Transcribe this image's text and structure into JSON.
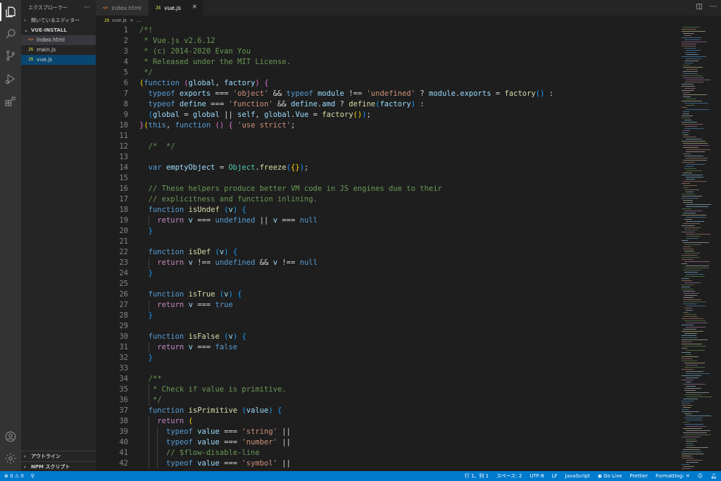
{
  "activity_bar": {
    "icons": [
      "files-icon",
      "search-icon",
      "source-control-icon",
      "run-debug-icon",
      "extensions-icon",
      "account-icon",
      "settings-gear-icon"
    ]
  },
  "sidebar": {
    "title": "エクスプローラー",
    "more": "···",
    "open_editors": "開いているエディター",
    "folder": "VUE-INSTALL",
    "files": [
      {
        "name": "index.html",
        "badge": "<>"
      },
      {
        "name": "main.js",
        "badge": "JS"
      },
      {
        "name": "vue.js",
        "badge": "JS"
      }
    ],
    "outline": "アウトライン",
    "npm_scripts": "NPM スクリプト"
  },
  "tabs": [
    {
      "label": "index.html",
      "badge": "<>"
    },
    {
      "label": "vue.js",
      "badge": "JS",
      "close": "×"
    }
  ],
  "breadcrumb": {
    "badge": "JS",
    "file": "vue.js",
    "sep": ">",
    "rest": "..."
  },
  "editor": {
    "lines": [
      {
        "n": "1",
        "html": "<span class=\"c\">/*!</span>"
      },
      {
        "n": "2",
        "html": "<span class=\"c\"> * Vue.js v2.6.12</span>"
      },
      {
        "n": "3",
        "html": "<span class=\"c\"> * (c) 2014-2020 Evan You</span>"
      },
      {
        "n": "4",
        "html": "<span class=\"c\"> * Released under the MIT License.</span>"
      },
      {
        "n": "5",
        "html": "<span class=\"c\"> */</span>"
      },
      {
        "n": "6",
        "html": "<span class=\"b1\">(</span><span class=\"k\">function</span> <span class=\"b2\">(</span><span class=\"v\">global</span>, <span class=\"v\">factory</span><span class=\"b2\">)</span> <span class=\"b2\">{</span>"
      },
      {
        "n": "7",
        "html": "  <span class=\"k\">typeof</span> <span class=\"v\">exports</span> === <span class=\"s\">'object'</span> &amp;&amp; <span class=\"k\">typeof</span> <span class=\"v\">module</span> !== <span class=\"s\">'undefined'</span> ? <span class=\"v\">module</span>.<span class=\"v\">exports</span> = <span class=\"f\">factory</span><span class=\"b3\">()</span> :"
      },
      {
        "n": "8",
        "html": "  <span class=\"k\">typeof</span> <span class=\"v\">define</span> === <span class=\"s\">'function'</span> &amp;&amp; <span class=\"v\">define</span>.<span class=\"v\">amd</span> ? <span class=\"f\">define</span><span class=\"b3\">(</span><span class=\"v\">factory</span><span class=\"b3\">)</span> :"
      },
      {
        "n": "9",
        "html": "  <span class=\"b3\">(</span><span class=\"v\">global</span> = <span class=\"v\">global</span> || <span class=\"v\">self</span>, <span class=\"v\">global</span>.<span class=\"v\">Vue</span> = <span class=\"f\">factory</span><span class=\"b1\">()</span><span class=\"b3\">)</span>;"
      },
      {
        "n": "10",
        "html": "<span class=\"b2\">}</span><span class=\"b1\">(</span><span class=\"k\">this</span>, <span class=\"k\">function</span> <span class=\"b2\">()</span> <span class=\"b2\">{</span> <span class=\"s\">'use strict'</span>;"
      },
      {
        "n": "11",
        "html": ""
      },
      {
        "n": "12",
        "html": "  <span class=\"c\">/*  */</span>"
      },
      {
        "n": "13",
        "html": ""
      },
      {
        "n": "14",
        "html": "  <span class=\"k\">var</span> <span class=\"v\">emptyObject</span> = <span class=\"t\">Object</span>.<span class=\"f\">freeze</span><span class=\"b3\">(</span><span class=\"b1\">{}</span><span class=\"b3\">)</span>;"
      },
      {
        "n": "15",
        "html": ""
      },
      {
        "n": "16",
        "html": "  <span class=\"c\">// These helpers produce better VM code in JS engines due to their</span>"
      },
      {
        "n": "17",
        "html": "  <span class=\"c\">// explicitness and function inlining.</span>"
      },
      {
        "n": "18",
        "html": "  <span class=\"k\">function</span> <span class=\"f\">isUndef</span> <span class=\"b3\">(</span><span class=\"v\">v</span><span class=\"b3\">)</span> <span class=\"b3\">{</span>"
      },
      {
        "n": "19",
        "html": "    <span class=\"ctl\">return</span> <span class=\"v\">v</span> === <span class=\"k\">undefined</span> || <span class=\"v\">v</span> === <span class=\"k\">null</span>"
      },
      {
        "n": "20",
        "html": "  <span class=\"b3\">}</span>"
      },
      {
        "n": "21",
        "html": ""
      },
      {
        "n": "22",
        "html": "  <span class=\"k\">function</span> <span class=\"f\">isDef</span> <span class=\"b3\">(</span><span class=\"v\">v</span><span class=\"b3\">)</span> <span class=\"b3\">{</span>"
      },
      {
        "n": "23",
        "html": "    <span class=\"ctl\">return</span> <span class=\"v\">v</span> !== <span class=\"k\">undefined</span> &amp;&amp; <span class=\"v\">v</span> !== <span class=\"k\">null</span>"
      },
      {
        "n": "24",
        "html": "  <span class=\"b3\">}</span>"
      },
      {
        "n": "25",
        "html": ""
      },
      {
        "n": "26",
        "html": "  <span class=\"k\">function</span> <span class=\"f\">isTrue</span> <span class=\"b3\">(</span><span class=\"v\">v</span><span class=\"b3\">)</span> <span class=\"b3\">{</span>"
      },
      {
        "n": "27",
        "html": "    <span class=\"ctl\">return</span> <span class=\"v\">v</span> === <span class=\"k\">true</span>"
      },
      {
        "n": "28",
        "html": "  <span class=\"b3\">}</span>"
      },
      {
        "n": "29",
        "html": ""
      },
      {
        "n": "30",
        "html": "  <span class=\"k\">function</span> <span class=\"f\">isFalse</span> <span class=\"b3\">(</span><span class=\"v\">v</span><span class=\"b3\">)</span> <span class=\"b3\">{</span>"
      },
      {
        "n": "31",
        "html": "    <span class=\"ctl\">return</span> <span class=\"v\">v</span> === <span class=\"k\">false</span>"
      },
      {
        "n": "32",
        "html": "  <span class=\"b3\">}</span>"
      },
      {
        "n": "33",
        "html": ""
      },
      {
        "n": "34",
        "html": "  <span class=\"c\">/**</span>"
      },
      {
        "n": "35",
        "html": "<span class=\"c\">   * Check if value is primitive.</span>"
      },
      {
        "n": "36",
        "html": "<span class=\"c\">   */</span>"
      },
      {
        "n": "37",
        "html": "  <span class=\"k\">function</span> <span class=\"f\">isPrimitive</span> <span class=\"b3\">(</span><span class=\"v\">value</span><span class=\"b3\">)</span> <span class=\"b3\">{</span>"
      },
      {
        "n": "38",
        "html": "    <span class=\"ctl\">return</span> <span class=\"b1\">(</span>"
      },
      {
        "n": "39",
        "html": "      <span class=\"k\">typeof</span> <span class=\"v\">value</span> === <span class=\"s\">'string'</span> ||"
      },
      {
        "n": "40",
        "html": "      <span class=\"k\">typeof</span> <span class=\"v\">value</span> === <span class=\"s\">'number'</span> ||"
      },
      {
        "n": "41",
        "html": "      <span class=\"c\">// $flow-disable-line</span>"
      },
      {
        "n": "42",
        "html": "      <span class=\"k\">typeof</span> <span class=\"v\">value</span> === <span class=\"s\">'symbol'</span> ||"
      }
    ]
  },
  "statusbar": {
    "errors": "0",
    "warnings": "0",
    "position": "行 1、列 1",
    "spaces": "スペース: 2",
    "encoding": "UTF-8",
    "eol": "LF",
    "language": "JavaScript",
    "golive": "Go Live",
    "prettier": "Prettier",
    "formatting": "Formatting:"
  },
  "colors": {
    "accent": "#007acc",
    "selection": "#094771",
    "js_icon": "#cbcb41",
    "html_icon": "#e37933"
  }
}
